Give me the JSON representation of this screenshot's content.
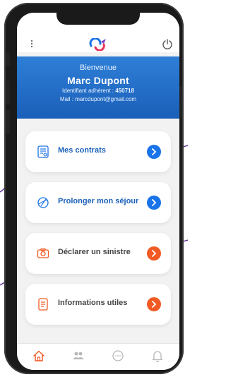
{
  "header": {
    "welcome": "Bienvenue",
    "name": "Marc Dupont",
    "member_id_label": "Identifiant adhérent :",
    "member_id": "450718",
    "email_label": "Mail :",
    "email": "marcdupont@gmail.com"
  },
  "cards": [
    {
      "label": "Mes contrats",
      "label_color": "#1a5fb8",
      "icon": "contract-icon",
      "arrow_color": "#1a73e8"
    },
    {
      "label": "Prolonger mon séjour",
      "label_color": "#1a5fb8",
      "icon": "globe-plane-icon",
      "arrow_color": "#1a73e8"
    },
    {
      "label": "Déclarer un sinistre",
      "label_color": "#444444",
      "icon": "camera-icon",
      "arrow_color": "#f15a24"
    },
    {
      "label": "Informations utiles",
      "label_color": "#444444",
      "icon": "document-icon",
      "arrow_color": "#f15a24"
    }
  ],
  "bottom_nav": [
    {
      "icon": "home-icon",
      "active": true
    },
    {
      "icon": "users-icon",
      "active": false
    },
    {
      "icon": "chat-icon",
      "active": false
    },
    {
      "icon": "bell-icon",
      "active": false
    }
  ],
  "colors": {
    "header_blue": "#1a5fb8",
    "accent_orange": "#f15a24",
    "accent_blue": "#1a73e8"
  }
}
